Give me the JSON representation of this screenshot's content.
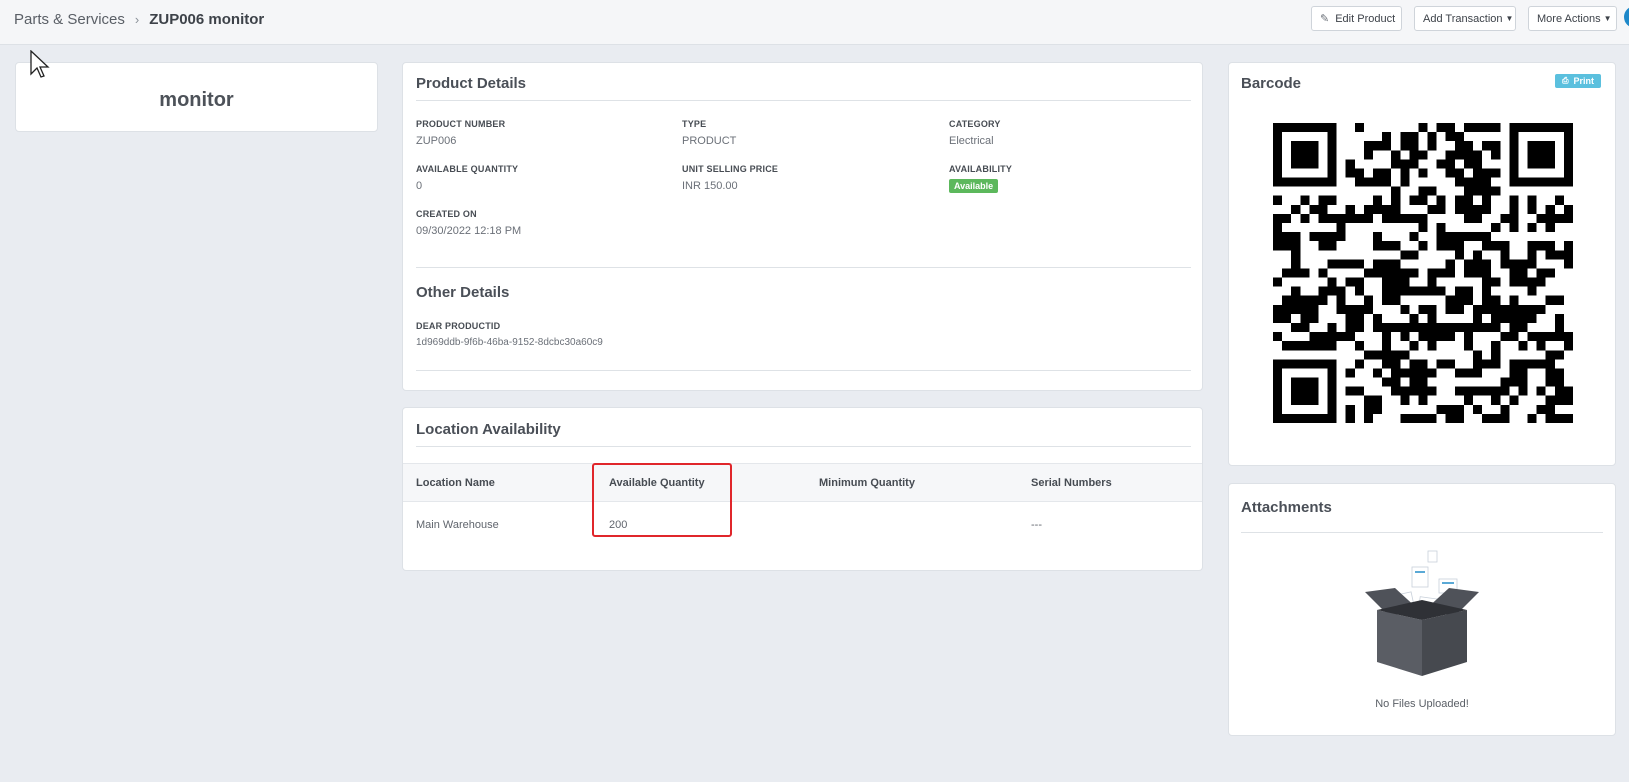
{
  "header": {
    "breadcrumb_parent": "Parts & Services",
    "breadcrumb_separator": "›",
    "breadcrumb_current": "ZUP006 monitor",
    "edit_product": "Edit Product",
    "add_transaction": "Add Transaction",
    "more_actions": "More Actions"
  },
  "summary": {
    "product_name": "monitor"
  },
  "product_details": {
    "title": "Product Details",
    "fields": {
      "product_number": {
        "label": "PRODUCT NUMBER",
        "value": "ZUP006"
      },
      "type": {
        "label": "TYPE",
        "value": "PRODUCT"
      },
      "category": {
        "label": "CATEGORY",
        "value": "Electrical"
      },
      "available_quantity": {
        "label": "AVAILABLE QUANTITY",
        "value": "0"
      },
      "unit_selling_price": {
        "label": "UNIT SELLING PRICE",
        "value": "INR 150.00"
      },
      "availability": {
        "label": "AVAILABILITY",
        "value": "Available"
      },
      "created_on": {
        "label": "CREATED ON",
        "value": "09/30/2022 12:18 PM"
      }
    }
  },
  "other_details": {
    "title": "Other Details",
    "dear_productid": {
      "label": "DEAR PRODUCTID",
      "value": "1d969ddb-9f6b-46ba-9152-8dcbc30a60c9"
    }
  },
  "location_availability": {
    "title": "Location Availability",
    "columns": [
      "Location Name",
      "Available Quantity",
      "Minimum Quantity",
      "Serial Numbers"
    ],
    "rows": [
      {
        "location_name": "Main Warehouse",
        "available_quantity": "200",
        "minimum_quantity": "",
        "serial_numbers": "---"
      }
    ]
  },
  "barcode": {
    "title": "Barcode",
    "print_label": "Print"
  },
  "attachments": {
    "title": "Attachments",
    "empty_text": "No Files Uploaded!"
  },
  "colors": {
    "accent": "#1e88c9",
    "badge_success": "#5cb85c",
    "print_button": "#5bc0de",
    "highlight": "#e0262b"
  },
  "icons": {
    "edit": "edit-icon",
    "print": "print-icon",
    "caret": "caret-down-icon",
    "empty_box": "empty-box-illustration"
  }
}
